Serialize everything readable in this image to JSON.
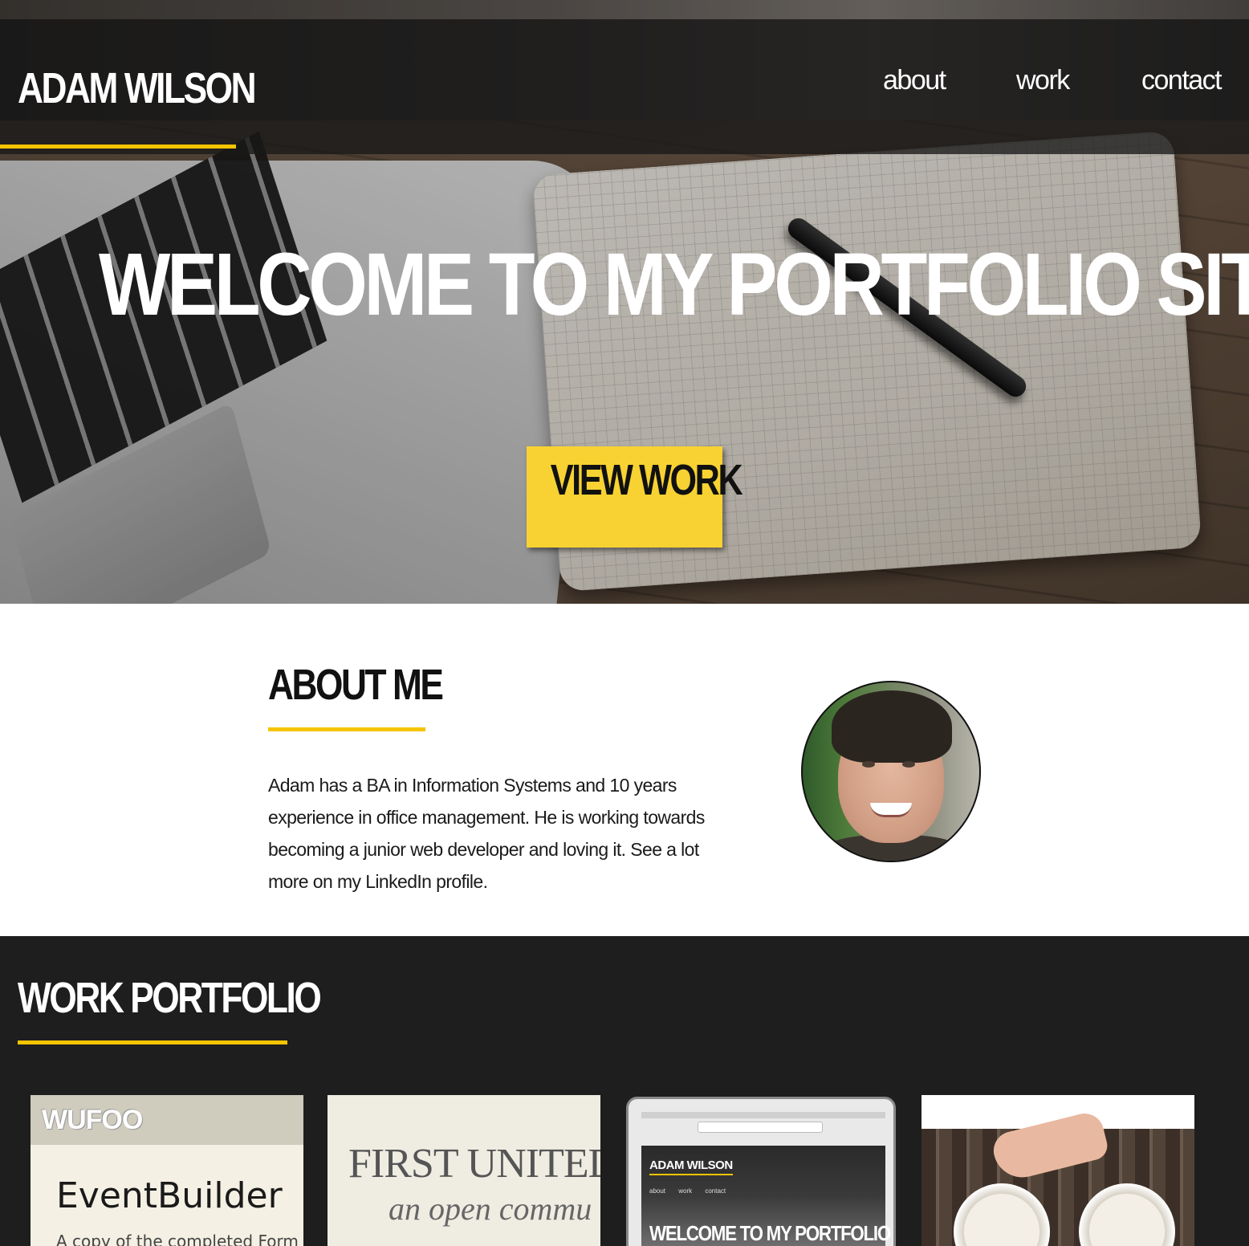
{
  "header": {
    "brand": "ADAM WILSON",
    "nav": [
      {
        "label": "about"
      },
      {
        "label": "work"
      },
      {
        "label": "contact"
      }
    ]
  },
  "hero": {
    "title": "WELCOME TO MY PORTFOLIO SITE",
    "cta_label": "VIEW WORK"
  },
  "about": {
    "heading": "ABOUT ME",
    "text": "Adam has a BA in Information Systems and 10 years experience in office management. He is working towards becoming a junior web developer and loving it. See a lot more on my LinkedIn profile.",
    "avatar_icon": "portrait-photo"
  },
  "work": {
    "heading": "WORK PORTFOLIO",
    "cards": [
      {
        "logo": "WUFOO",
        "title": "EventBuilder",
        "subtitle": "A copy of the completed Form"
      },
      {
        "title": "FIRST UNITED",
        "subtitle": "an open commu"
      },
      {
        "brand": "ADAM WILSON",
        "nav": "about work contact",
        "title": "WELCOME TO MY PORTFOLIO"
      },
      {
        "image": "coffee-cups-photo"
      }
    ]
  },
  "colors": {
    "accent": "#f5c400",
    "cta": "#f8d232",
    "dark_section": "#1e1e1e"
  }
}
